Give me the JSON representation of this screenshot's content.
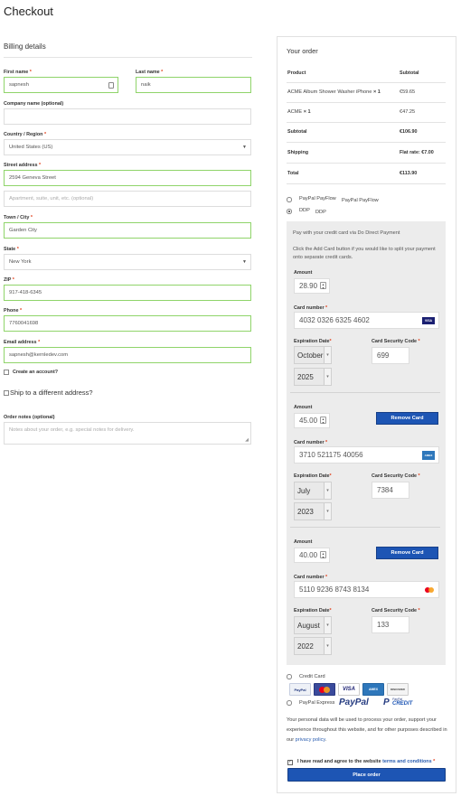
{
  "page": {
    "title": "Checkout"
  },
  "billing": {
    "heading": "Billing details",
    "first_name": {
      "label": "First name",
      "value": "sapnesh"
    },
    "last_name": {
      "label": "Last name",
      "value": "naik"
    },
    "company": {
      "label": "Company name (optional)",
      "value": ""
    },
    "country": {
      "label": "Country / Region",
      "value": "United States (US)"
    },
    "street": {
      "label": "Street address",
      "value": "2594 Geneva Street",
      "placeholder2": "Apartment, suite, unit, etc. (optional)"
    },
    "city": {
      "label": "Town / City",
      "value": "Garden City"
    },
    "state": {
      "label": "State",
      "value": "New York"
    },
    "zip": {
      "label": "ZIP",
      "value": "917-418-6345"
    },
    "phone": {
      "label": "Phone",
      "value": "7760041698"
    },
    "email": {
      "label": "Email address",
      "value": "sapnesh@kernledev.com"
    },
    "create_account": "Create an account?",
    "ship_different": "Ship to a different address?",
    "notes": {
      "label": "Order notes (optional)",
      "placeholder": "Notes about your order, e.g. special notes for delivery."
    },
    "required_mark": "*"
  },
  "order": {
    "heading": "Your order",
    "col_product": "Product",
    "col_subtotal": "Subtotal",
    "items": [
      {
        "name": "ACME Album Shower Washer iPhone",
        "qty": "× 1",
        "price": "€59.65"
      },
      {
        "name": "ACME",
        "qty": "× 1",
        "price": "€47.25"
      }
    ],
    "subtotal": {
      "label": "Subtotal",
      "value": "€106.90"
    },
    "shipping": {
      "label": "Shipping",
      "value": "Flat rate: €7.00"
    },
    "total": {
      "label": "Total",
      "value": "€113.90"
    }
  },
  "payment": {
    "paypal_flow": {
      "label": "PayPal PayFlow",
      "desc": "PayPal PayFlow"
    },
    "ddp": {
      "label": "DDP",
      "desc": "DDP"
    },
    "box_text1": "Pay with your credit card via Do Direct Payment",
    "box_text2": "Click the Add Card button if you would like to split your payment onto separate credit cards.",
    "labels": {
      "amount": "Amount",
      "card_number": "Card number",
      "exp": "Expiration Date",
      "csc": "Card Security Code",
      "remove": "Remove Card"
    },
    "cards": [
      {
        "amount": "28.90",
        "number": "4032 0326 6325 4602",
        "brand": "VISA",
        "month": "October",
        "year": "2025",
        "csc": "699"
      },
      {
        "amount": "45.00",
        "number": "3710 521175 40056",
        "brand": "AMEX",
        "month": "July",
        "year": "2023",
        "csc": "7384"
      },
      {
        "amount": "40.00",
        "number": "5110 9236 8743 8134",
        "brand": "MC",
        "month": "August",
        "year": "2022",
        "csc": "133"
      }
    ],
    "credit_card": {
      "label": "Credit Card",
      "logos": [
        "PayPal",
        "MC",
        "VISA",
        "AMEX",
        "DISCOVER"
      ]
    },
    "paypal_express": {
      "label": "PayPal Express",
      "logo1": "PayPal",
      "logo2_top": "PayPal",
      "logo2_bottom": "CREDIT"
    },
    "privacy_text": "Your personal data will be used to process your order, support your experience throughout this website, and for other purposes described in our",
    "privacy_link": "privacy policy",
    "terms_prefix": "I have read and agree to the website",
    "terms_link": "terms and conditions",
    "place_order": "Place order"
  },
  "colors": {
    "accent": "#1d55b4",
    "valid": "#8fd46a",
    "required": "#e2401c",
    "link": "#2a5db0"
  }
}
